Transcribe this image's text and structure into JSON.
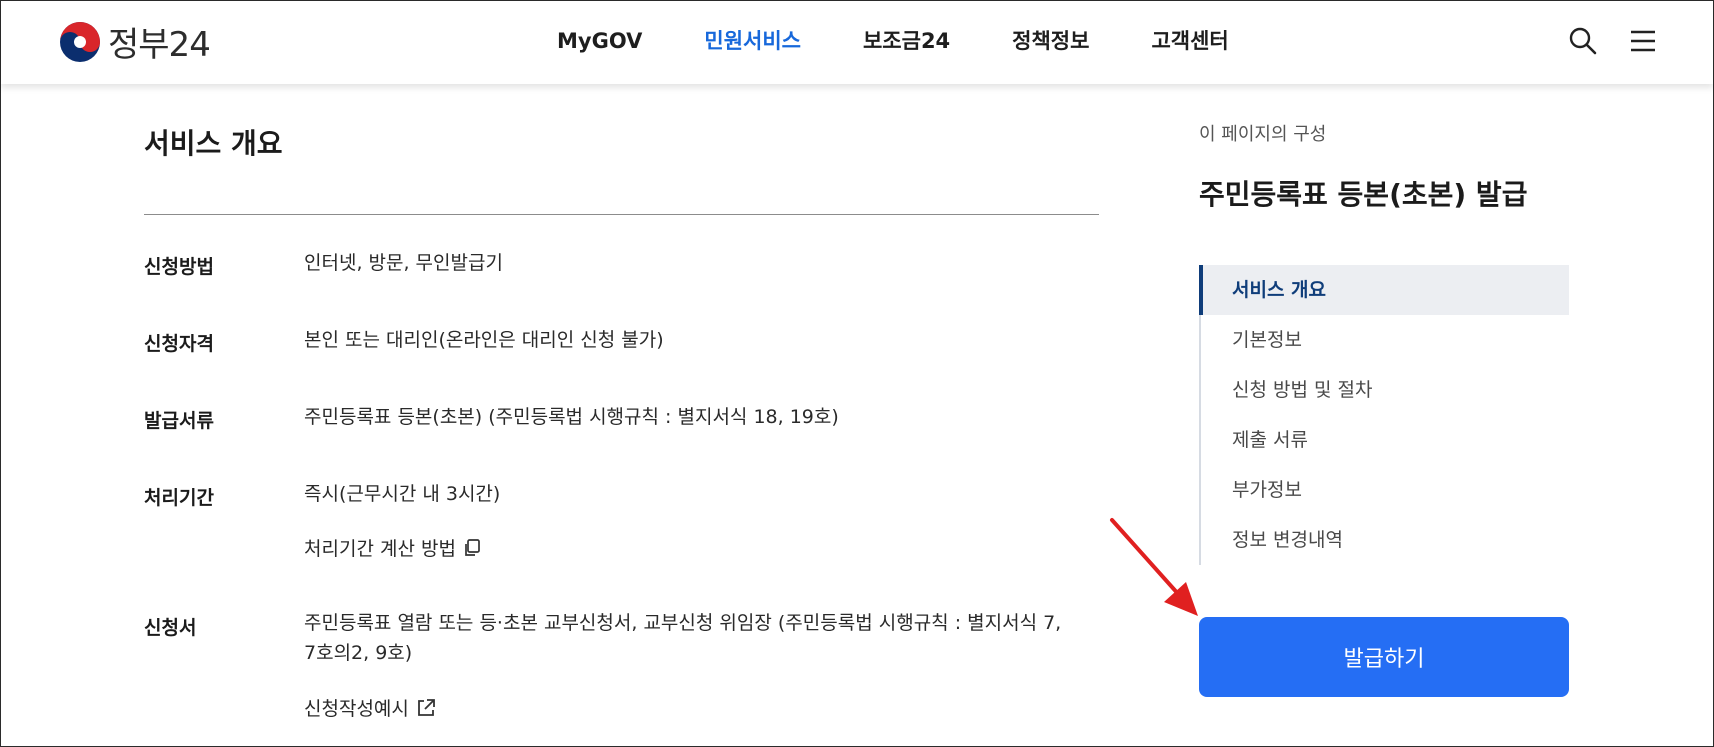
{
  "header": {
    "logo_text": "정부24",
    "nav": [
      "MyGOV",
      "민원서비스",
      "보조금24",
      "정책정보",
      "고객센터"
    ],
    "active_nav": "민원서비스",
    "icons": [
      "search-icon",
      "menu-icon"
    ]
  },
  "main": {
    "section_title": "서비스 개요",
    "rows": [
      {
        "label": "신청방법",
        "value": "인터넷, 방문, 무인발급기"
      },
      {
        "label": "신청자격",
        "value": "본인 또는 대리인(온라인은 대리인 신청 불가)"
      },
      {
        "label": "발급서류",
        "value": "주민등록표 등본(초본) (주민등록법 시행규칙 : 별지서식 18, 19호)"
      },
      {
        "label": "처리기간",
        "value": "즉시(근무시간 내 3시간)",
        "link": "처리기간 계산 방법"
      },
      {
        "label": "신청서",
        "value_line1": "주민등록표 열람 또는 등·초본 교부신청서, 교부신청 위임장 (주민등록법 시행규칙 : 별지서식 7,",
        "value_line2": "7호의2, 9호)",
        "link": "신청작성예시"
      }
    ]
  },
  "toc": {
    "caption": "이 페이지의 구성",
    "title": "주민등록표 등본(초본) 발급",
    "items": [
      "서비스 개요",
      "기본정보",
      "신청 방법 및 절차",
      "제출 서류",
      "부가정보",
      "정보 변경내역"
    ],
    "active_item": "서비스 개요"
  },
  "action": {
    "issue_button": "발급하기"
  },
  "colors": {
    "accent": "#1768db",
    "button": "#256ef4",
    "toc_active": "#0f3d7a",
    "annotation_arrow": "#e02020"
  }
}
